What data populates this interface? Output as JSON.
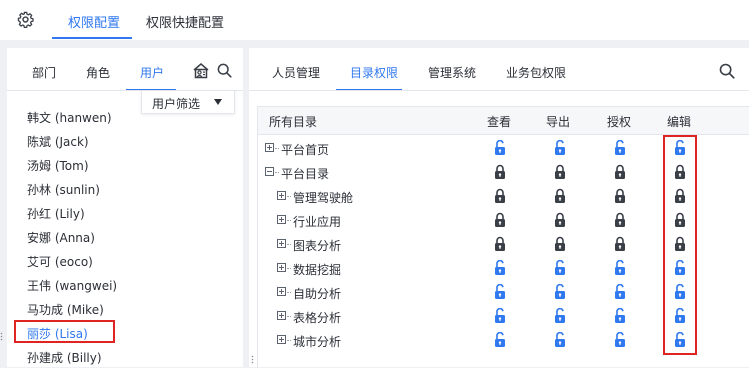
{
  "top_tabs": [
    "权限配置",
    "权限快捷配置"
  ],
  "left_tabs": [
    "部门",
    "角色",
    "用户"
  ],
  "user_filter": "用户筛选",
  "users": [
    "韩文 (hanwen)",
    "陈斌 (Jack)",
    "汤姆 (Tom)",
    "孙林 (sunlin)",
    "孙红 (Lily)",
    "安娜 (Anna)",
    "艾可 (eoco)",
    "王伟 (wangwei)",
    "马功成 (Mike)",
    "丽莎 (Lisa)",
    "孙建成 (Billy)"
  ],
  "selected_user_index": 9,
  "right_tabs": [
    "人员管理",
    "目录权限",
    "管理系统",
    "业务包权限"
  ],
  "table": {
    "headers": [
      "所有目录",
      "查看",
      "导出",
      "授权",
      "编辑"
    ],
    "rows": [
      {
        "label": "平台首页",
        "level": 0,
        "expander": "plus",
        "perms": [
          "unlocked",
          "unlocked",
          "unlocked",
          "unlocked"
        ]
      },
      {
        "label": "平台目录",
        "level": 0,
        "expander": "minus",
        "perms": [
          "locked",
          "locked",
          "locked",
          "locked"
        ]
      },
      {
        "label": "管理驾驶舱",
        "level": 1,
        "expander": "plus",
        "perms": [
          "locked",
          "locked",
          "locked",
          "locked"
        ]
      },
      {
        "label": "行业应用",
        "level": 1,
        "expander": "plus",
        "perms": [
          "locked",
          "locked",
          "locked",
          "locked"
        ]
      },
      {
        "label": "图表分析",
        "level": 1,
        "expander": "plus",
        "perms": [
          "locked",
          "locked",
          "locked",
          "locked"
        ]
      },
      {
        "label": "数据挖掘",
        "level": 1,
        "expander": "plus",
        "perms": [
          "unlocked",
          "unlocked",
          "unlocked",
          "unlocked"
        ]
      },
      {
        "label": "自助分析",
        "level": 1,
        "expander": "plus",
        "perms": [
          "unlocked",
          "unlocked",
          "unlocked",
          "unlocked"
        ]
      },
      {
        "label": "表格分析",
        "level": 1,
        "expander": "plus",
        "perms": [
          "unlocked",
          "unlocked",
          "unlocked",
          "unlocked"
        ]
      },
      {
        "label": "城市分析",
        "level": 1,
        "expander": "plus",
        "perms": [
          "unlocked",
          "unlocked",
          "unlocked",
          "unlocked"
        ]
      }
    ]
  },
  "icons": {
    "settings": "gear-icon",
    "add_user": "add-user-icon",
    "search": "search-icon",
    "locked": "lock-icon",
    "unlocked": "unlock-icon"
  },
  "colors": {
    "accent": "#2f78ef",
    "locked_icon": "#3a3f47",
    "highlight_box": "#e02424",
    "background": "#eef0f3"
  }
}
